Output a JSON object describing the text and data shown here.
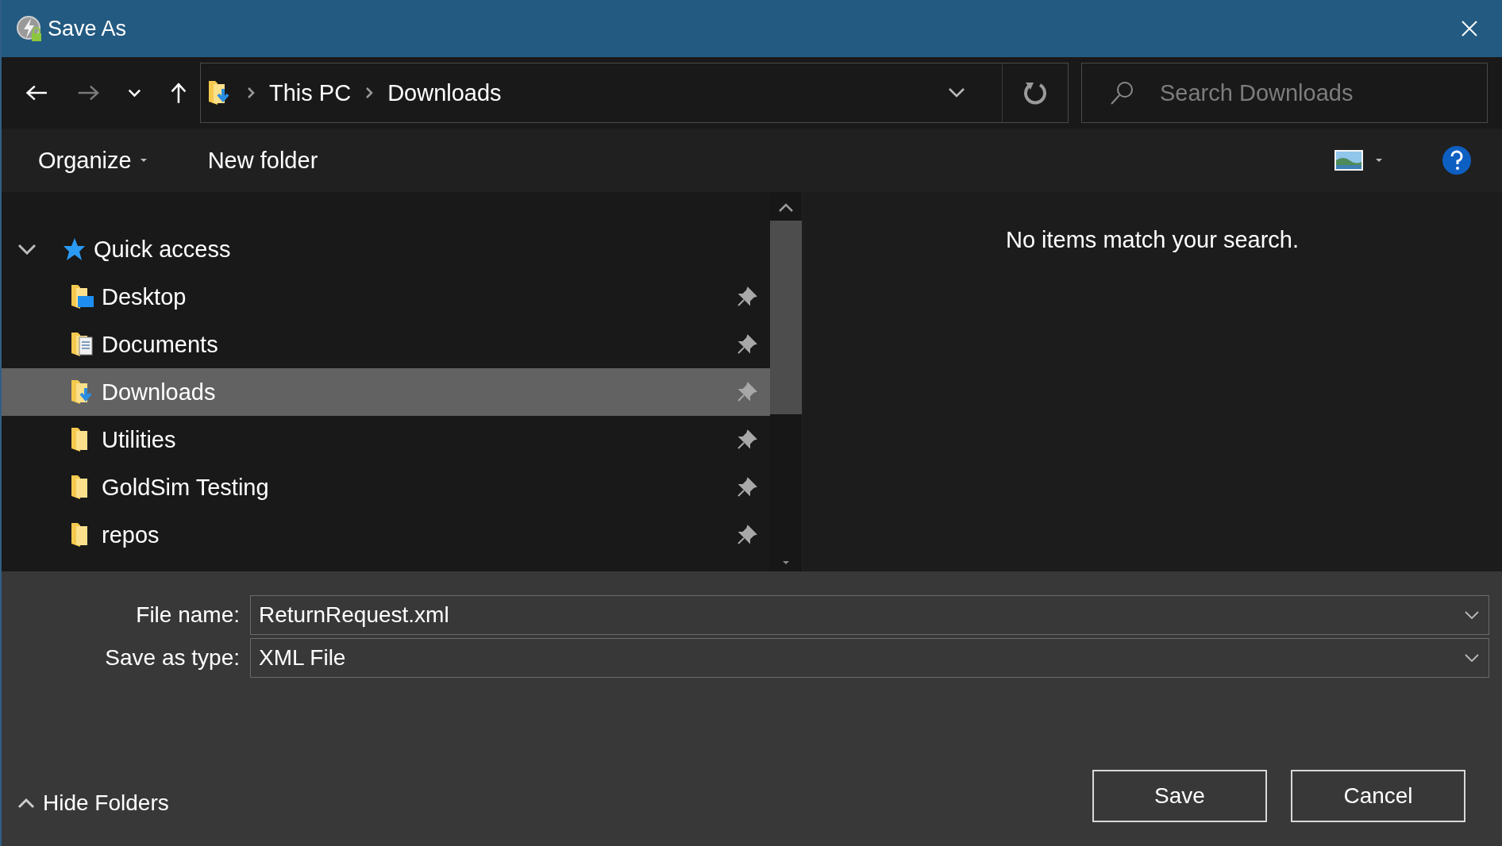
{
  "window": {
    "title": "Save As"
  },
  "nav_buttons": [
    {
      "kind": "back",
      "disabled": false
    },
    {
      "kind": "forward",
      "disabled": true
    },
    {
      "kind": "recent",
      "disabled": false
    },
    {
      "kind": "up",
      "disabled": false
    }
  ],
  "breadcrumb": [
    "This PC",
    "Downloads"
  ],
  "search": {
    "placeholder": "Search Downloads"
  },
  "toolbar": {
    "organize": "Organize",
    "new_folder": "New folder"
  },
  "sidebar": {
    "label": "Quick access",
    "expanded": true,
    "children": [
      {
        "label": "Desktop",
        "kind": "desktop",
        "selected": false,
        "pinned": true
      },
      {
        "label": "Documents",
        "kind": "documents",
        "selected": false,
        "pinned": true
      },
      {
        "label": "Downloads",
        "kind": "downloads",
        "selected": true,
        "pinned": true
      },
      {
        "label": "Utilities",
        "kind": "folder",
        "selected": false,
        "pinned": true
      },
      {
        "label": "GoldSim Testing",
        "kind": "folder",
        "selected": false,
        "pinned": true
      },
      {
        "label": "repos",
        "kind": "folder",
        "selected": false,
        "pinned": true
      }
    ]
  },
  "content": {
    "message": "No items match your search."
  },
  "form": [
    {
      "label": "File name:",
      "value": "ReturnRequest.xml"
    },
    {
      "label": "Save as type:",
      "value": "XML File"
    }
  ],
  "hide_folders": "Hide Folders",
  "buttons": [
    "Save",
    "Cancel"
  ]
}
